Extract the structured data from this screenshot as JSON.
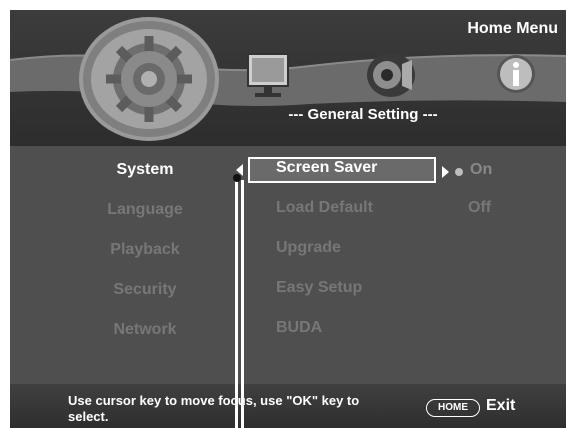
{
  "header": {
    "title": "Home Menu",
    "section_title": "--- General Setting ---",
    "tabs": [
      {
        "name": "general-setting",
        "icon": "gear-icon",
        "selected": true
      },
      {
        "name": "display",
        "icon": "monitor-icon",
        "selected": false
      },
      {
        "name": "audio",
        "icon": "speaker-icon",
        "selected": false
      },
      {
        "name": "information",
        "icon": "info-icon",
        "selected": false
      }
    ]
  },
  "categories": [
    {
      "label": "System",
      "active": true
    },
    {
      "label": "Language",
      "active": false
    },
    {
      "label": "Playback",
      "active": false
    },
    {
      "label": "Security",
      "active": false
    },
    {
      "label": "Network",
      "active": false
    }
  ],
  "options": [
    {
      "label": "Screen Saver",
      "selected": true
    },
    {
      "label": "Load Default",
      "selected": false
    },
    {
      "label": "Upgrade",
      "selected": false
    },
    {
      "label": "Easy Setup",
      "selected": false
    },
    {
      "label": "BUDA",
      "selected": false
    }
  ],
  "values": [
    {
      "label": "On",
      "current": true
    },
    {
      "label": "Off",
      "current": false
    }
  ],
  "footer": {
    "hint": "Use cursor key to move focus, use \"OK\" key to select.",
    "home_key": "HOME",
    "exit_label": "Exit"
  },
  "colors": {
    "background": "#4f4f4f",
    "active_text": "#ffffff",
    "inactive_text": "#777777",
    "highlight": "#6a6a6a"
  }
}
